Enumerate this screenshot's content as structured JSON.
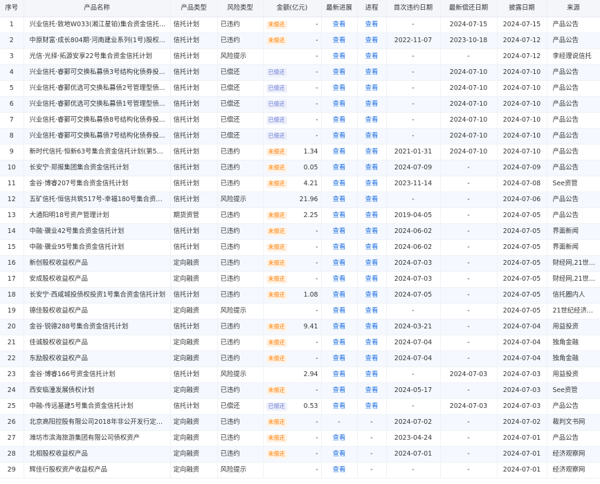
{
  "columns": [
    "序号",
    "产品名称",
    "产品类型",
    "风险类型",
    "金额(亿元)",
    "最新进展",
    "进程",
    "首次违约日期",
    "最新偿还日期",
    "披露日期",
    "来源"
  ],
  "status_colors": {
    "未偿还": "#ff7d00",
    "已偿还": "#6a7bd6",
    "link": "#1d6fe0"
  },
  "rows": [
    {
      "idx": "1",
      "name": "兴业信托·致地W033(湘江星铂)集合资金信托...",
      "ptype": "信托计划",
      "risk": "已违约",
      "status": "未偿还",
      "amount": "-",
      "progress": "查看",
      "process": "查看",
      "first_default": "-",
      "latest_repay": "2024-07-15",
      "disclose": "2024-07-15",
      "source": "产品公告"
    },
    {
      "idx": "2",
      "name": "中原财富·成长804期·河南建业系列(1号)股权...",
      "ptype": "信托计划",
      "risk": "已违约",
      "status": "未偿还",
      "amount": "-",
      "progress": "查看",
      "process": "查看",
      "first_default": "2022-11-07",
      "latest_repay": "2023-10-18",
      "disclose": "2024-07-12",
      "source": "产品公告"
    },
    {
      "idx": "3",
      "name": "光信·光择·拓源安享22号集合资金信托计划",
      "ptype": "信托计划",
      "risk": "风险提示",
      "status": "",
      "amount": "-",
      "progress": "查看",
      "process": "查看",
      "first_default": "-",
      "latest_repay": "-",
      "disclose": "2024-07-12",
      "source": "李经理说信托"
    },
    {
      "idx": "4",
      "name": "兴业信托·睿鄞可交换私募债3号结构化债券投...",
      "ptype": "信托计划",
      "risk": "已偿还",
      "status": "已偿还",
      "amount": "-",
      "progress": "查看",
      "process": "查看",
      "first_default": "-",
      "latest_repay": "2024-07-10",
      "disclose": "2024-07-10",
      "source": "产品公告"
    },
    {
      "idx": "5",
      "name": "兴业信托·睿鄞优选可交换私募债2号管理型债...",
      "ptype": "信托计划",
      "risk": "已偿还",
      "status": "已偿还",
      "amount": "-",
      "progress": "查看",
      "process": "查看",
      "first_default": "-",
      "latest_repay": "2024-07-10",
      "disclose": "2024-07-10",
      "source": "产品公告"
    },
    {
      "idx": "6",
      "name": "兴业信托·睿鄞优选可交换私募债1号管理型债...",
      "ptype": "信托计划",
      "risk": "已偿还",
      "status": "已偿还",
      "amount": "-",
      "progress": "查看",
      "process": "查看",
      "first_default": "-",
      "latest_repay": "2024-07-10",
      "disclose": "2024-07-10",
      "source": "产品公告"
    },
    {
      "idx": "7",
      "name": "兴业信托·睿鄞可交换私募债8号结构化债券投...",
      "ptype": "信托计划",
      "risk": "已偿还",
      "status": "已偿还",
      "amount": "-",
      "progress": "查看",
      "process": "查看",
      "first_default": "-",
      "latest_repay": "2024-07-10",
      "disclose": "2024-07-10",
      "source": "产品公告"
    },
    {
      "idx": "8",
      "name": "兴业信托·睿鄞可交换私募债7号结构化债券投...",
      "ptype": "信托计划",
      "risk": "已偿还",
      "status": "已偿还",
      "amount": "-",
      "progress": "查看",
      "process": "查看",
      "first_default": "-",
      "latest_repay": "2024-07-10",
      "disclose": "2024-07-10",
      "source": "产品公告"
    },
    {
      "idx": "9",
      "name": "新时代信托·恒新63号集合资金信托计划(第55期)",
      "ptype": "信托计划",
      "risk": "已违约",
      "status": "未偿还",
      "amount": "1.34",
      "progress": "查看",
      "process": "查看",
      "first_default": "2021-01-31",
      "latest_repay": "2024-07-10",
      "disclose": "2024-07-10",
      "source": "产品公告"
    },
    {
      "idx": "10",
      "name": "长安宁·郑报集团集合资金信托计划",
      "ptype": "信托计划",
      "risk": "已违约",
      "status": "未偿还",
      "amount": "0.05",
      "progress": "查看",
      "process": "查看",
      "first_default": "2024-07-09",
      "latest_repay": "-",
      "disclose": "2024-07-09",
      "source": "产品公告"
    },
    {
      "idx": "11",
      "name": "金谷·博睿207号集合资金信托计划",
      "ptype": "信托计划",
      "risk": "已违约",
      "status": "未偿还",
      "amount": "4.21",
      "progress": "查看",
      "process": "查看",
      "first_default": "2023-11-14",
      "latest_repay": "-",
      "disclose": "2024-07-08",
      "source": "See资管"
    },
    {
      "idx": "12",
      "name": "五矿信托·恒信共筑517号-幸福180号集合资金...",
      "ptype": "信托计划",
      "risk": "风险提示",
      "status": "",
      "amount": "21.96",
      "progress": "查看",
      "process": "查看",
      "first_default": "-",
      "latest_repay": "-",
      "disclose": "2024-07-06",
      "source": "产品公告"
    },
    {
      "idx": "13",
      "name": "大通阳明18号资产管理计划",
      "ptype": "期货资管",
      "risk": "已违约",
      "status": "未偿还",
      "amount": "2.25",
      "progress": "查看",
      "process": "查看",
      "first_default": "2019-04-05",
      "latest_repay": "-",
      "disclose": "2024-07-05",
      "source": "产品公告"
    },
    {
      "idx": "14",
      "name": "中融·骥业42号集合资金信托计划",
      "ptype": "信托计划",
      "risk": "已违约",
      "status": "未偿还",
      "amount": "-",
      "progress": "查看",
      "process": "查看",
      "first_default": "2024-06-02",
      "latest_repay": "-",
      "disclose": "2024-07-05",
      "source": "界面新闻"
    },
    {
      "idx": "15",
      "name": "中融·骥业95号集合资金信托计划",
      "ptype": "信托计划",
      "risk": "已违约",
      "status": "未偿还",
      "amount": "-",
      "progress": "查看",
      "process": "查看",
      "first_default": "2024-06-02",
      "latest_repay": "-",
      "disclose": "2024-07-05",
      "source": "界面新闻"
    },
    {
      "idx": "16",
      "name": "新创股权收益权产品",
      "ptype": "定向融资",
      "risk": "已违约",
      "status": "未偿还",
      "amount": "-",
      "progress": "查看",
      "process": "查看",
      "first_default": "2024-07-03",
      "latest_repay": "-",
      "disclose": "2024-07-05",
      "source": "财经网,21世..."
    },
    {
      "idx": "17",
      "name": "安成股权收益权产品",
      "ptype": "定向融资",
      "risk": "已违约",
      "status": "未偿还",
      "amount": "-",
      "progress": "查看",
      "process": "查看",
      "first_default": "2024-07-03",
      "latest_repay": "-",
      "disclose": "2024-07-05",
      "source": "财经网,21世..."
    },
    {
      "idx": "18",
      "name": "长安宁·西咸城投债权投资1号集合资金信托计划",
      "ptype": "信托计划",
      "risk": "已违约",
      "status": "未偿还",
      "amount": "1.08",
      "progress": "查看",
      "process": "查看",
      "first_default": "2024-07-05",
      "latest_repay": "-",
      "disclose": "2024-07-05",
      "source": "信托圈内人"
    },
    {
      "idx": "19",
      "name": "德佳股权收益权产品",
      "ptype": "定向融资",
      "risk": "风险提示",
      "status": "",
      "amount": "-",
      "progress": "查看",
      "process": "查看",
      "first_default": "-",
      "latest_repay": "-",
      "disclose": "2024-07-05",
      "source": "21世纪经济..."
    },
    {
      "idx": "20",
      "name": "金谷·锐德288号集合资金信托计划",
      "ptype": "信托计划",
      "risk": "已违约",
      "status": "未偿还",
      "amount": "9.41",
      "progress": "查看",
      "process": "查看",
      "first_default": "2024-03-21",
      "latest_repay": "-",
      "disclose": "2024-07-04",
      "source": "用益投资"
    },
    {
      "idx": "21",
      "name": "佳诚股权收益权产品",
      "ptype": "定向融资",
      "risk": "已违约",
      "status": "未偿还",
      "amount": "-",
      "progress": "查看",
      "process": "查看",
      "first_default": "2024-07-04",
      "latest_repay": "-",
      "disclose": "2024-07-04",
      "source": "独角金融"
    },
    {
      "idx": "22",
      "name": "东励股权收益权产品",
      "ptype": "定向融资",
      "risk": "已违约",
      "status": "未偿还",
      "amount": "-",
      "progress": "查看",
      "process": "查看",
      "first_default": "2024-07-04",
      "latest_repay": "-",
      "disclose": "2024-07-04",
      "source": "独角金融"
    },
    {
      "idx": "23",
      "name": "金谷·博睿166号资金信托计划",
      "ptype": "信托计划",
      "risk": "风险提示",
      "status": "",
      "amount": "2.94",
      "progress": "查看",
      "process": "查看",
      "first_default": "-",
      "latest_repay": "2024-07-03",
      "disclose": "2024-07-03",
      "source": "用益投资"
    },
    {
      "idx": "24",
      "name": "西安临潼发展债权计划",
      "ptype": "定向融资",
      "risk": "已违约",
      "status": "未偿还",
      "amount": "-",
      "progress": "查看",
      "process": "查看",
      "first_default": "2024-05-17",
      "latest_repay": "-",
      "disclose": "2024-07-03",
      "source": "See资管"
    },
    {
      "idx": "25",
      "name": "中融-传远基建5号集合资金信托计划",
      "ptype": "信托计划",
      "risk": "已偿还",
      "status": "已偿还",
      "amount": "0.53",
      "progress": "查看",
      "process": "查看",
      "first_default": "-",
      "latest_repay": "2024-07-03",
      "disclose": "2024-07-03",
      "source": "产品公告"
    },
    {
      "idx": "26",
      "name": "北京高阳控股有限公司2018年非公开发行定向...",
      "ptype": "定向融资",
      "risk": "已违约",
      "status": "未偿还",
      "amount": "-",
      "progress": "-",
      "process": "-",
      "first_default": "2024-07-02",
      "latest_repay": "-",
      "disclose": "2024-07-02",
      "source": "裁判文书网"
    },
    {
      "idx": "27",
      "name": "潍坊市滨海旅游集团有限公司债权资产",
      "ptype": "定向融资",
      "risk": "已违约",
      "status": "未偿还",
      "amount": "-",
      "progress": "查看",
      "process": "-",
      "first_default": "2023-04-24",
      "latest_repay": "-",
      "disclose": "2024-07-01",
      "source": "产品公告"
    },
    {
      "idx": "28",
      "name": "北相股权收益权产品",
      "ptype": "定向融资",
      "risk": "已违约",
      "status": "未偿还",
      "amount": "-",
      "progress": "查看",
      "process": "-",
      "first_default": "2024-07-01",
      "latest_repay": "-",
      "disclose": "2024-07-01",
      "source": "经济观察网"
    },
    {
      "idx": "29",
      "name": "辉佳行股权资产收益权产品",
      "ptype": "定向融资",
      "risk": "风险提示",
      "status": "",
      "amount": "-",
      "progress": "查看",
      "process": "-",
      "first_default": "-",
      "latest_repay": "-",
      "disclose": "2024-07-01",
      "source": "经济观察网"
    }
  ]
}
